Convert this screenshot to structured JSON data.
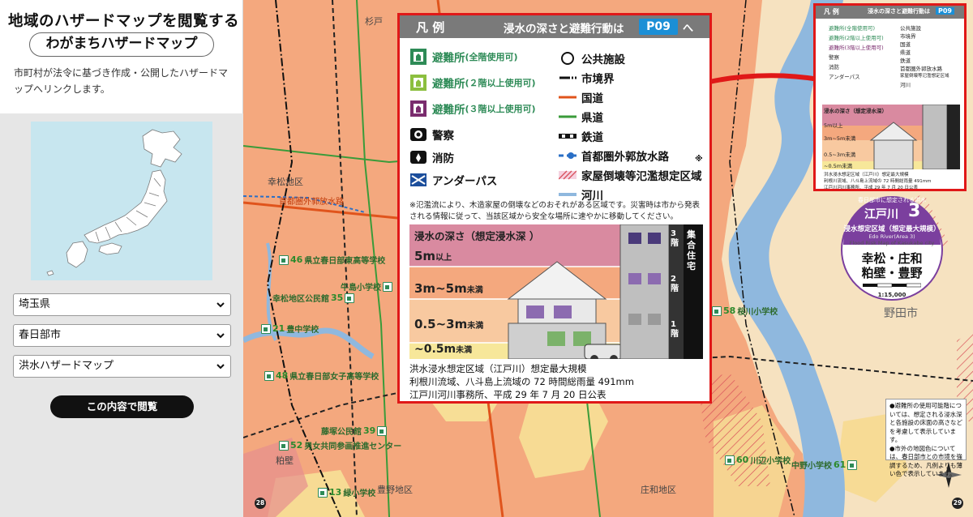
{
  "sidebar": {
    "title": "地域のハザードマップを閲覧する",
    "pill": "わがまちハザードマップ",
    "description": "市町村が法令に基づき作成・公開したハザードマップへリンクします。",
    "prefecture": "埼玉県",
    "city": "春日部市",
    "map_type": "洪水ハザードマップ",
    "view_button": "この内容で閲覧"
  },
  "legend": {
    "title": "凡 例",
    "subtitle": "浸水の深さと避難行動は",
    "page_tag": "P09",
    "page_suffix": "へ",
    "left_items": [
      {
        "label": "避難所",
        "note": "(全階使用可)"
      },
      {
        "label": "避難所",
        "note": "(２階以上使用可)"
      },
      {
        "label": "避難所",
        "note": "(３階以上使用可)"
      },
      {
        "label": "警察",
        "note": ""
      },
      {
        "label": "消防",
        "note": ""
      },
      {
        "label": "アンダーパス",
        "note": ""
      }
    ],
    "right_items": [
      "公共施設",
      "市境界",
      "国道",
      "県道",
      "鉄道",
      "首都圏外郭放水路",
      "家屋倒壊等氾濫想定区域",
      "河川"
    ],
    "asterisk": "※",
    "note": "※氾濫流により、木造家屋の倒壊などのおそれがある区域です。災害時は市から発表　　される情報に従って、当該区域から安全な場所に速やかに移動してください。",
    "depth": {
      "title": "浸水の深さ（想定浸水深 ）",
      "levels": [
        {
          "main": "5m",
          "suffix": "以上"
        },
        {
          "main": "3m~5m",
          "suffix": "未満"
        },
        {
          "main": "0.5~3m",
          "suffix": "未満"
        },
        {
          "main": "~0.5m",
          "suffix": "未満"
        }
      ],
      "floors": [
        "3階",
        "2階",
        "1階"
      ],
      "building_label": "集合住宅"
    },
    "footer": [
      "洪水浸水想定区域（江戸川）想定最大規模",
      "利根川流域、八斗島上流域の 72 時間総雨量 491mm",
      "江戸川河川事務所、平成 29 年 7 月 20 日公表"
    ]
  },
  "mini_legend": {
    "title": "凡 例",
    "subtitle": "浸水の深さと避難行動は",
    "page_tag": "P09",
    "left_items": [
      "避難所(全階使用可)",
      "避難所(2階以上使用可)",
      "避難所(3階以上使用可)",
      "警察",
      "消防",
      "アンダーパス"
    ],
    "right_items": [
      "公共施設",
      "市境界",
      "国道",
      "県道",
      "鉄道",
      "首都圏外郭放水路",
      "家屋倒壊等氾濫想定区域",
      "河川"
    ],
    "depth_title": "浸水の深さ（想定浸水深）",
    "depth_levels": [
      "5m以上",
      "3m~5m未満",
      "0.5~3m未満",
      "~0.5m未満"
    ],
    "footer": [
      "洪水浸水想定区域（江戸川）想定最大規模",
      "利根川流域、八斗島上流域の 72 時間総雨量 491mm",
      "江戸川河川事務所、平成 29 年 7 月 20 日公表"
    ]
  },
  "badge": {
    "top_text": "春日部市に想定される洪水",
    "river": "江戸川",
    "area_num": "3",
    "scale_type": "浸水想定区域（想定最大規模）",
    "english": "Edo River(Area 3)",
    "english2": "Flood Risk Map of Kasukabe city",
    "districts": [
      "幸松・庄和",
      "粕壁・豊野"
    ],
    "scale": "1:15,000"
  },
  "right_note": "●避難所の使用可能階については、想定される浸水深と各施設の床面の高さなどを考慮して表示しています。\n●市外の地図色については、春日部市との市境を強調するため、凡例よりも薄い色で表示しています。",
  "map_labels": {
    "districts": [
      "幸松地区",
      "豊野地区",
      "庄和地区",
      "粕壁"
    ],
    "city": "野田市",
    "top_cut": "杉戸",
    "road_labels": [
      "首都圏外郭放水路"
    ],
    "facilities": [
      {
        "num": "46",
        "name": "県立春日部東高等学校"
      },
      {
        "num": "35",
        "name": "幸松地区公民館"
      },
      {
        "num": "",
        "name": "牛島小学校"
      },
      {
        "num": "21",
        "name": "豊中学校"
      },
      {
        "num": "48",
        "name": "県立春日部女子高等学校"
      },
      {
        "num": "39",
        "name": "藤塚公民館"
      },
      {
        "num": "52",
        "name": "男女共同参画推進センター"
      },
      {
        "num": "13",
        "name": "緑小学校"
      },
      {
        "num": "58",
        "name": "桜川小学校"
      },
      {
        "num": "60",
        "name": "川辺小学校"
      },
      {
        "num": "61",
        "name": "中野小学校"
      }
    ],
    "page_left": "28",
    "page_right": "29"
  },
  "colors": {
    "accent_red": "#e01818",
    "pink_5m": "#d98aa0",
    "orange_3m": "#f4a87e",
    "peach_05m": "#f8c9a0",
    "yellow_low": "#f7e79a",
    "road_national": "#e0541c",
    "road_pref": "#3a9b3a",
    "river": "#8fb8de",
    "shelter_green": "#2e8b57",
    "shelter_purple": "#7a2c6e",
    "tag_blue": "#1b8fd6",
    "badge_purple": "#7b3f9e"
  }
}
